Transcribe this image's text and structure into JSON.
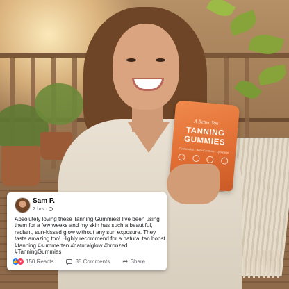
{
  "product": {
    "brand": "A Better You",
    "title": "TANNING GUMMIES",
    "subtitle": "Carotenoids · Beta-Carotene · Lycopene",
    "footer": "Formulated for a Radiant Tan"
  },
  "post": {
    "author": "Sam P.",
    "time": "2 hrs ·",
    "text": "Absolutely loving these Tanning Gummies! I've been using them for a few weeks and my skin has such a beautiful, radiant,  sun-kissed glow without any sun exposure. They taste  amazing too! Highly recommend for a natural tan boost. #tanning #summertan #naturalglow #bronzed #TanningGummies",
    "reactions_label": "150 Reacts",
    "comments_label": "35 Comments",
    "share_label": "Share"
  },
  "icons": {
    "like": "like-icon",
    "love": "heart-icon",
    "comment": "comment-icon",
    "share": "share-icon",
    "privacy": "globe-icon"
  },
  "colors": {
    "pouch": "#e06c32",
    "like_blue": "#1877f2",
    "love_red": "#f33e58",
    "meta_gray": "#65676b"
  }
}
